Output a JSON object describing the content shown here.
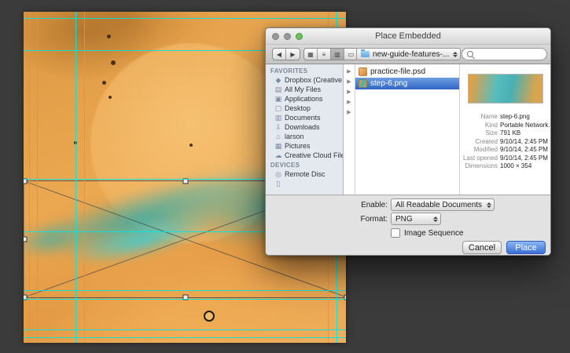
{
  "colors": {
    "pasteboard": "#3b3b3b",
    "artwork_orange": "#e9a44f",
    "artwork_teal": "#3bb7b4",
    "guide_cyan": "#00e6e6",
    "selection_blue": "#3b77d8",
    "place_button_blue": "#4a84e4"
  },
  "dialog": {
    "title": "Place Embedded",
    "toolbar": {
      "back_glyph": "◀",
      "forward_glyph": "▶",
      "view_modes": [
        {
          "name": "icon-view",
          "glyph": "▦"
        },
        {
          "name": "list-view",
          "glyph": "≡"
        },
        {
          "name": "column-view",
          "glyph": "▥"
        },
        {
          "name": "coverflow-view",
          "glyph": "▭"
        }
      ],
      "path_dropdown": "new-guide-features-...",
      "search_placeholder": ""
    },
    "browser": {
      "chevron_glyph": "▶"
    },
    "sidebar": {
      "favorites_header": "FAVORITES",
      "favorites": [
        {
          "label": "Dropbox (Creative Cl...",
          "icon": "dropbox-icon",
          "glyph": "◆"
        },
        {
          "label": "All My Files",
          "icon": "all-my-files-icon",
          "glyph": "▤"
        },
        {
          "label": "Applications",
          "icon": "applications-icon",
          "glyph": "▣"
        },
        {
          "label": "Desktop",
          "icon": "desktop-icon",
          "glyph": "▢"
        },
        {
          "label": "Documents",
          "icon": "documents-icon",
          "glyph": "▥"
        },
        {
          "label": "Downloads",
          "icon": "downloads-icon",
          "glyph": "⇩"
        },
        {
          "label": "larson",
          "icon": "home-icon",
          "glyph": "⌂"
        },
        {
          "label": "Pictures",
          "icon": "pictures-icon",
          "glyph": "▦"
        },
        {
          "label": "Creative Cloud Files",
          "icon": "creative-cloud-icon",
          "glyph": "☁"
        }
      ],
      "devices_header": "DEVICES",
      "devices": [
        {
          "label": "Remote Disc",
          "icon": "remote-disc-icon",
          "glyph": "◎"
        },
        {
          "label": "",
          "icon": "device-icon",
          "glyph": "▯"
        }
      ]
    },
    "files": [
      {
        "name": "practice-file.psd"
      },
      {
        "name": "step-6.png"
      }
    ],
    "preview": {
      "info": [
        {
          "label": "Name",
          "value": "step-6.png"
        },
        {
          "label": "Kind",
          "value": "Portable Network..."
        },
        {
          "label": "Size",
          "value": "791 KB"
        },
        {
          "label": "Created",
          "value": "9/10/14, 2:45 PM"
        },
        {
          "label": "Modified",
          "value": "9/10/14, 2:45 PM"
        },
        {
          "label": "Last opened",
          "value": "9/10/14, 2:45 PM"
        },
        {
          "label": "Dimensions",
          "value": "1000 × 354"
        }
      ]
    },
    "options": {
      "enable_label": "Enable:",
      "enable_value": "All Readable Documents",
      "format_label": "Format:",
      "format_value": "PNG",
      "image_sequence_label": "Image Sequence"
    },
    "buttons": {
      "cancel": "Cancel",
      "place": "Place"
    }
  }
}
